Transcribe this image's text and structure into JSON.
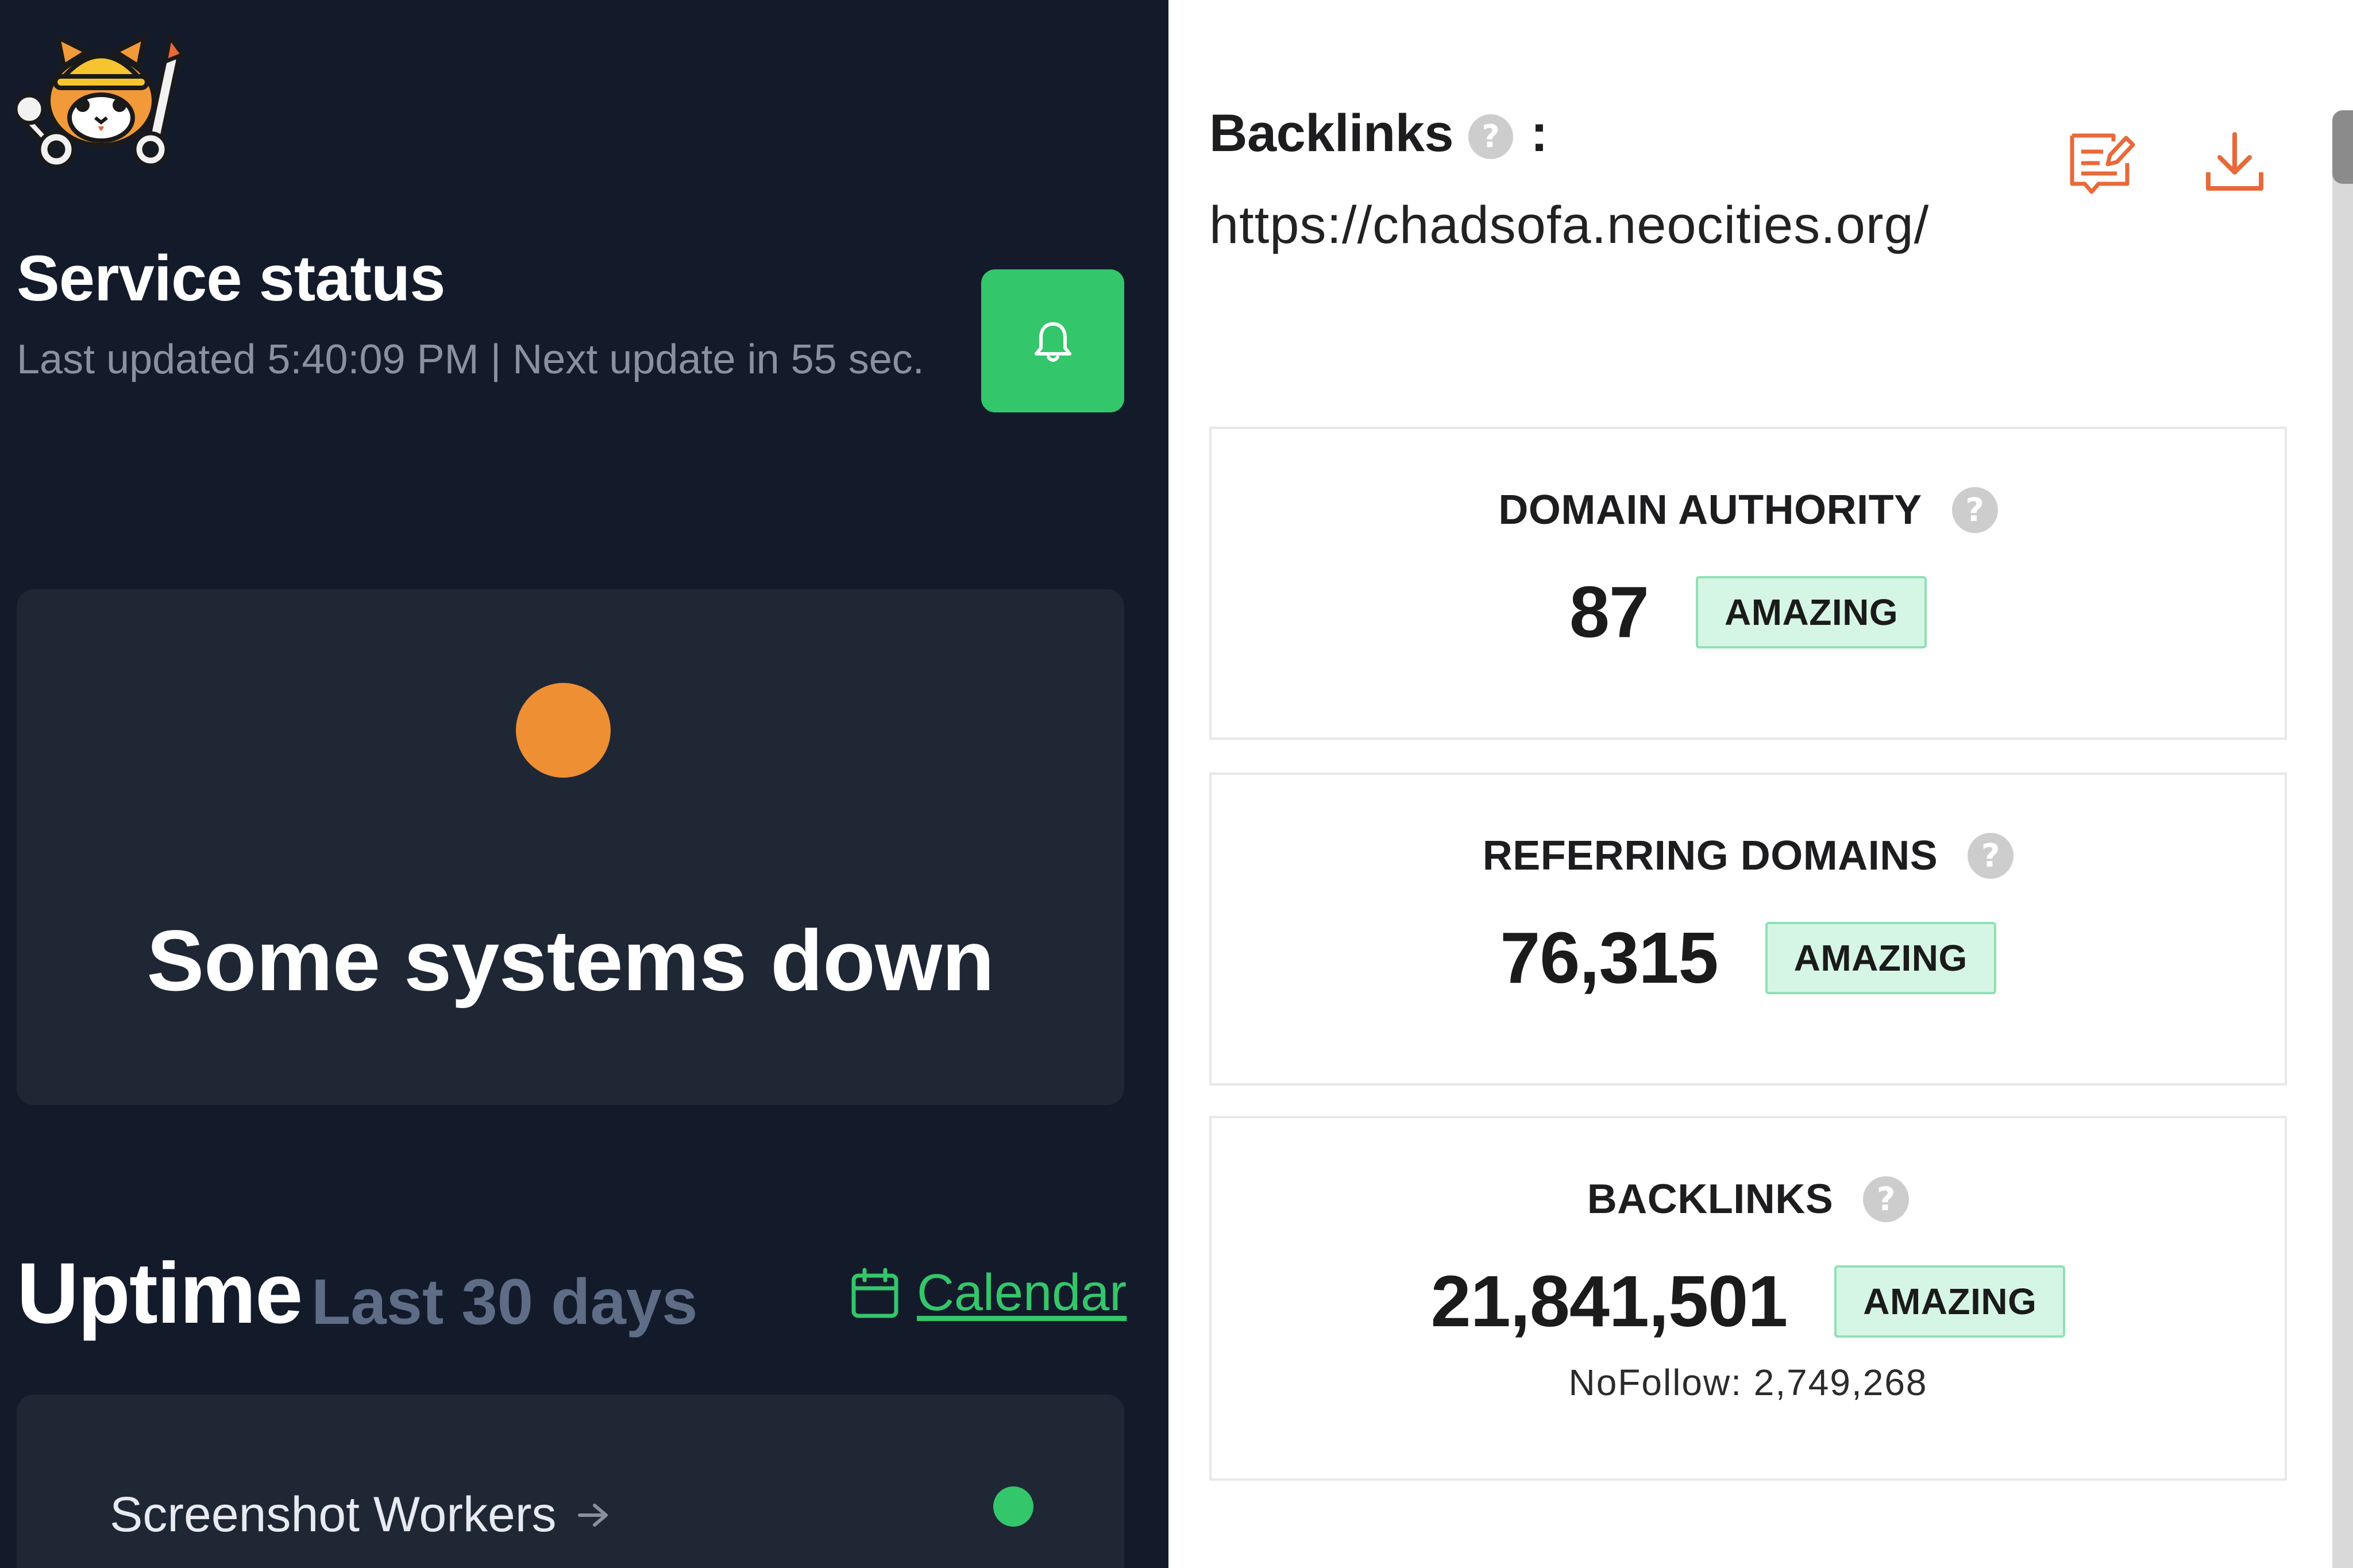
{
  "service": {
    "title": "Service status",
    "last_updated": "Last updated 5:40:09 PM | Next update in 55 sec.",
    "alert_icon": "bell-icon",
    "status_text": "Some systems down",
    "status_color": "#ef8f33",
    "uptime_title": "Uptime",
    "uptime_sub": "Last 30 days",
    "calendar_label": "Calendar",
    "worker_label": "Screenshot Workers",
    "worker_status_color": "#34c66b",
    "accent": "#34c66b"
  },
  "backlinks": {
    "title": "Backlinks",
    "colon": ":",
    "help": "?",
    "url": "https://chadsofa.neocities.org/",
    "actions": [
      "edit-report-icon",
      "download-icon"
    ],
    "accent": "#e8693a",
    "metrics": [
      {
        "label": "DOMAIN AUTHORITY",
        "value": "87",
        "badge": "AMAZING"
      },
      {
        "label": "REFERRING DOMAINS",
        "value": "76,315",
        "badge": "AMAZING"
      },
      {
        "label": "BACKLINKS",
        "value": "21,841,501",
        "badge": "AMAZING",
        "note": "NoFollow: 2,749,268"
      }
    ]
  }
}
